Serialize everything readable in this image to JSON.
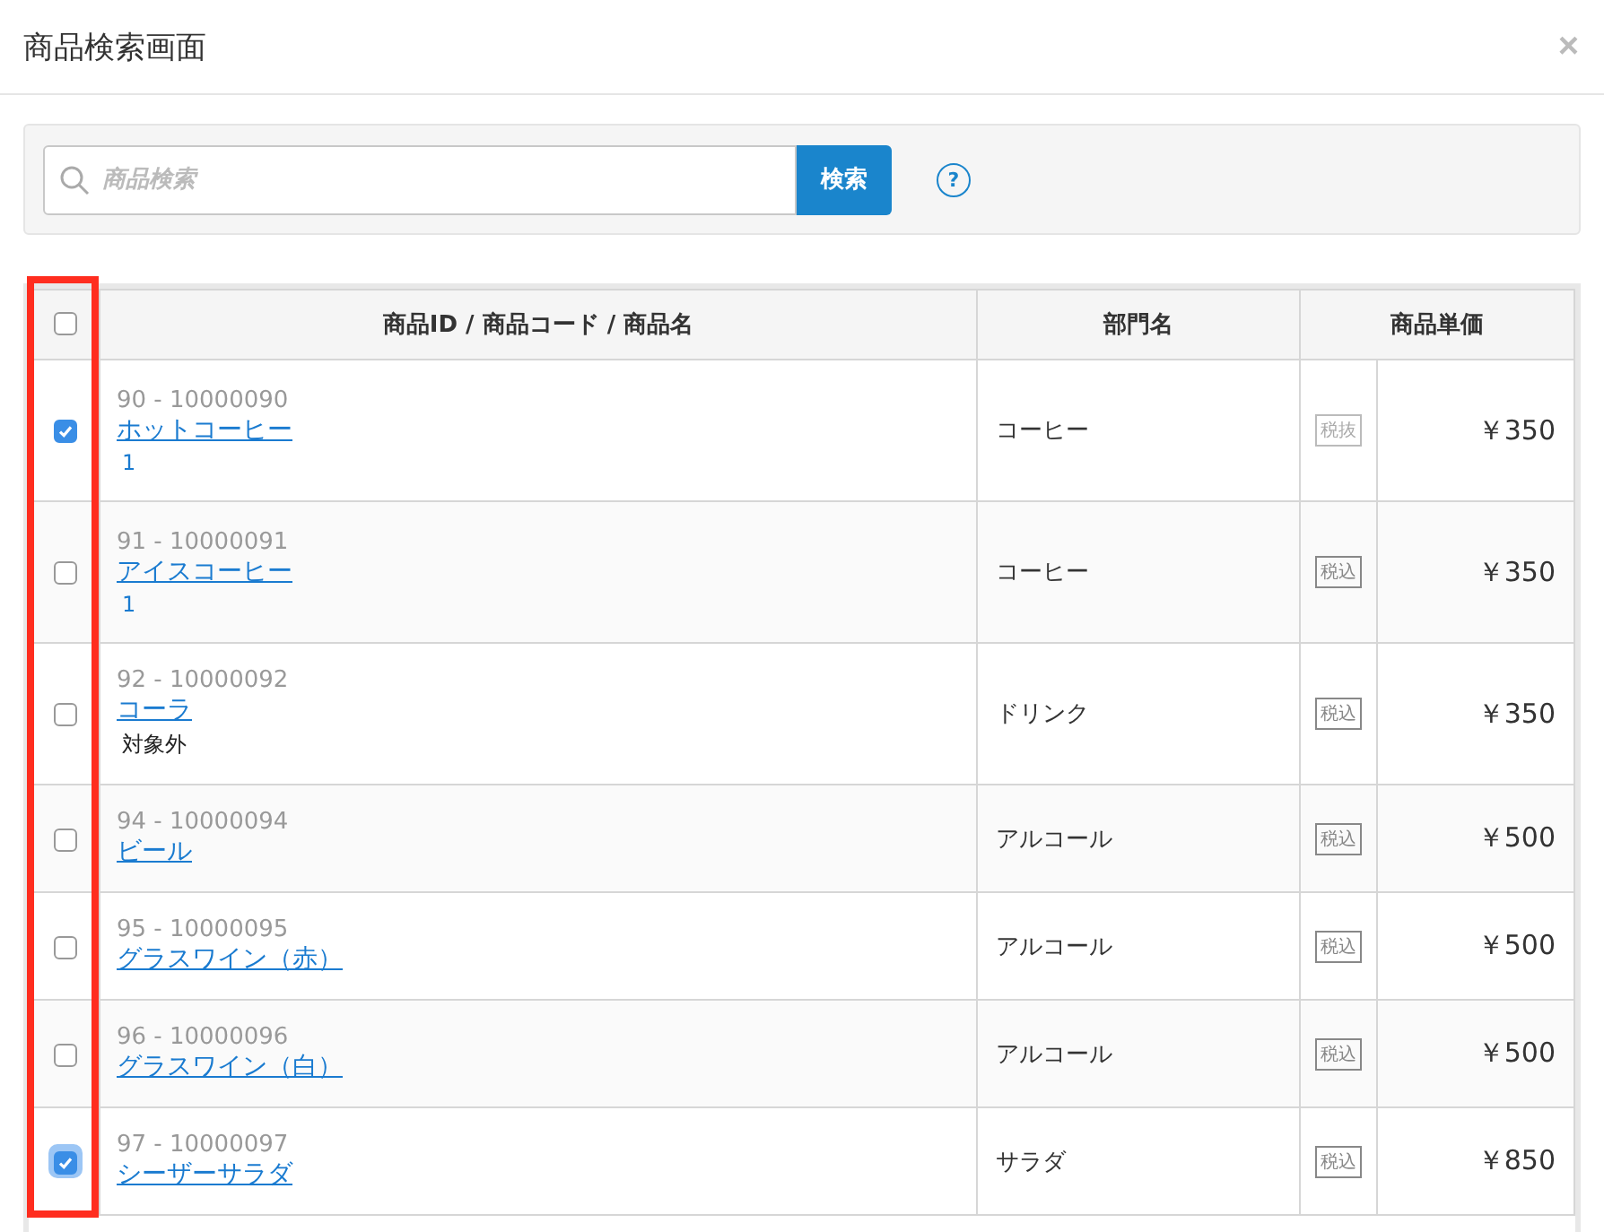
{
  "dialog": {
    "title": "商品検索画面",
    "close": "×"
  },
  "search": {
    "placeholder": "商品検索",
    "button": "検索",
    "help": "?"
  },
  "table": {
    "highlight_select_column": true,
    "select_all": {
      "checked": false
    },
    "columns": [
      "商品ID / 商品コード / 商品名",
      "部門名",
      "商品単価"
    ],
    "rows": [
      {
        "checked": true,
        "focused": false,
        "code": "90 - 10000090",
        "name": "ホットコーヒー",
        "note": {
          "kind": "count",
          "text": "1"
        },
        "department": "コーヒー",
        "tax": "税抜",
        "tax_included": false,
        "price": "￥350"
      },
      {
        "checked": false,
        "focused": false,
        "code": "91 - 10000091",
        "name": "アイスコーヒー",
        "note": {
          "kind": "count",
          "text": "1"
        },
        "department": "コーヒー",
        "tax": "税込",
        "tax_included": true,
        "price": "￥350"
      },
      {
        "checked": false,
        "focused": false,
        "code": "92 - 10000092",
        "name": "コーラ",
        "note": {
          "kind": "excluded",
          "text": "対象外"
        },
        "department": "ドリンク",
        "tax": "税込",
        "tax_included": true,
        "price": "￥350"
      },
      {
        "checked": false,
        "focused": false,
        "code": "94 - 10000094",
        "name": "ビール",
        "department": "アルコール",
        "tax": "税込",
        "tax_included": true,
        "price": "￥500"
      },
      {
        "checked": false,
        "focused": false,
        "code": "95 - 10000095",
        "name": "グラスワイン（赤）",
        "department": "アルコール",
        "tax": "税込",
        "tax_included": true,
        "price": "￥500"
      },
      {
        "checked": false,
        "focused": false,
        "code": "96 - 10000096",
        "name": "グラスワイン（白）",
        "department": "アルコール",
        "tax": "税込",
        "tax_included": true,
        "price": "￥500"
      },
      {
        "checked": true,
        "focused": true,
        "code": "97 - 10000097",
        "name": "シーザーサラダ",
        "department": "サラダ",
        "tax": "税込",
        "tax_included": true,
        "price": "￥850"
      }
    ]
  }
}
